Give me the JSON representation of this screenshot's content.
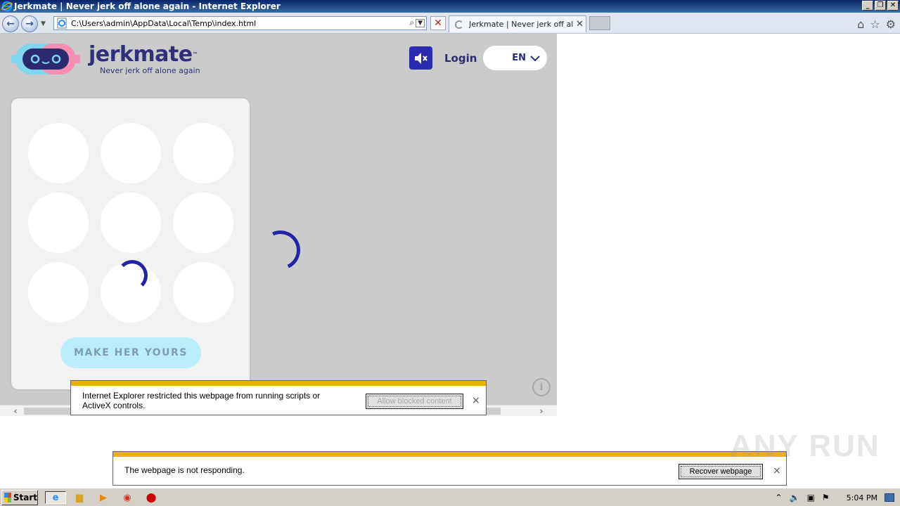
{
  "window": {
    "title": "Jerkmate | Never jerk off alone again - Internet Explorer",
    "buttons": [
      "_",
      "❐",
      "✕"
    ]
  },
  "browser": {
    "address_url": "C:\\Users\\admin\\AppData\\Local\\Temp\\index.html",
    "tab_label": "Jerkmate | Never jerk off alo...",
    "tab_close": "✕",
    "stop_glyph": "✕"
  },
  "site": {
    "logo_name": "jerkmate",
    "logo_tm": "™",
    "tagline": "Never jerk off alone again",
    "login_label": "Login",
    "language": "EN",
    "cta_label": "MAKE HER YOURS",
    "info_glyph": "i"
  },
  "infobar_scripts": {
    "message": "Internet Explorer restricted this webpage from running scripts or ActiveX controls.",
    "button_label": "Allow blocked content",
    "close": "×"
  },
  "infobar_hang": {
    "message": "The webpage is not responding.",
    "button_label": "Recover webpage",
    "close": "×"
  },
  "watermark": "ANY RUN",
  "taskbar": {
    "start_label": "Start",
    "clock": "5:04 PM"
  },
  "colors": {
    "accent": "#2b2bb0",
    "brand_text": "#2f2f7a",
    "cta_bg": "#b9eefa",
    "infobar_stripe": "#e8b100"
  }
}
